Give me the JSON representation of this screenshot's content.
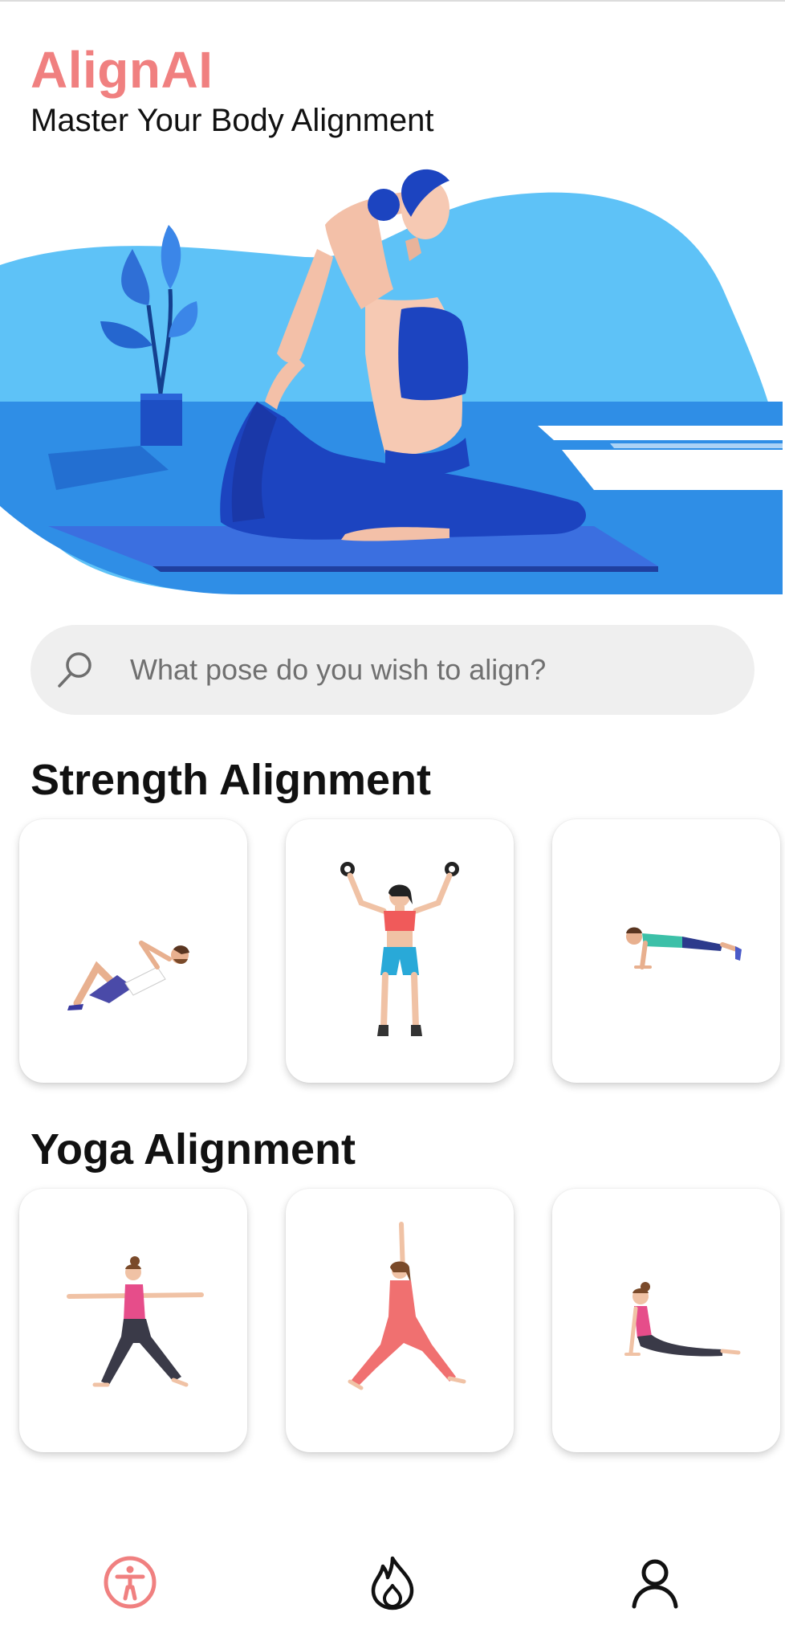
{
  "header": {
    "app_title": "AlignAI",
    "subtitle": "Master Your Body Alignment"
  },
  "search": {
    "placeholder": "What pose do you wish to align?"
  },
  "sections": [
    {
      "title": "Strength Alignment",
      "cards": [
        {
          "icon": "crunch-exercise-icon"
        },
        {
          "icon": "dumbbell-press-icon"
        },
        {
          "icon": "plank-exercise-icon"
        }
      ]
    },
    {
      "title": "Yoga Alignment",
      "cards": [
        {
          "icon": "warrior-two-pose-icon"
        },
        {
          "icon": "warrior-one-pose-icon"
        },
        {
          "icon": "cobra-pose-icon"
        }
      ]
    }
  ],
  "bottom_nav": [
    {
      "icon": "accessibility-icon",
      "active": true
    },
    {
      "icon": "flame-icon",
      "active": false
    },
    {
      "icon": "user-icon",
      "active": false
    }
  ],
  "colors": {
    "accent": "#f08080",
    "hero_blue": "#2f8ee6",
    "hero_light_blue": "#5ec2f7",
    "mat_blue": "#3b6fe0",
    "search_bg": "#efefef"
  }
}
